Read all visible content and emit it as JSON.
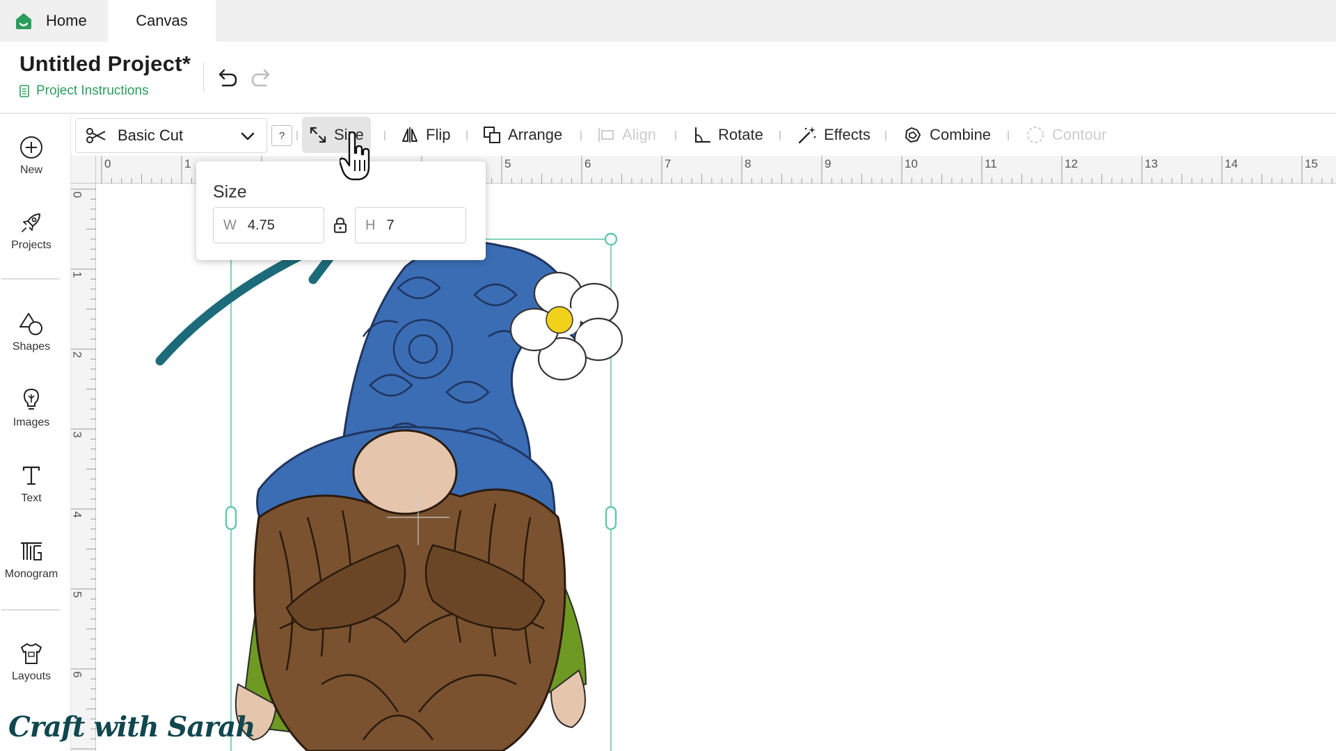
{
  "tabs": {
    "home_label": "Home",
    "canvas_label": "Canvas"
  },
  "header": {
    "title": "Untitled Project*",
    "instructions_link": "Project Instructions"
  },
  "toolbar": {
    "operation": "Basic Cut",
    "help": "?",
    "size": "Size",
    "flip": "Flip",
    "arrange": "Arrange",
    "align": "Align",
    "rotate": "Rotate",
    "effects": "Effects",
    "combine": "Combine",
    "contour": "Contour"
  },
  "sidebar": {
    "new": "New",
    "projects": "Projects",
    "shapes": "Shapes",
    "images": "Images",
    "text": "Text",
    "monogram": "Monogram",
    "layouts": "Layouts"
  },
  "ruler": {
    "top": [
      "0",
      "1",
      "5",
      "6",
      "7",
      "8",
      "9",
      "10",
      "11",
      "12",
      "13",
      "14",
      "15"
    ],
    "left": [
      "0",
      "1",
      "2",
      "3",
      "4",
      "5",
      "6"
    ]
  },
  "size_popover": {
    "title": "Size",
    "w_label": "W",
    "w_value": "4.75",
    "h_label": "H",
    "h_value": "7"
  },
  "watermark": "Craft with Sarah",
  "colors": {
    "brand_green": "#2a9d5c",
    "hat_blue": "#3b6db5",
    "beard_brown": "#7a5230",
    "arrow_teal": "#1d6b7a",
    "selection": "#62c9a4"
  }
}
